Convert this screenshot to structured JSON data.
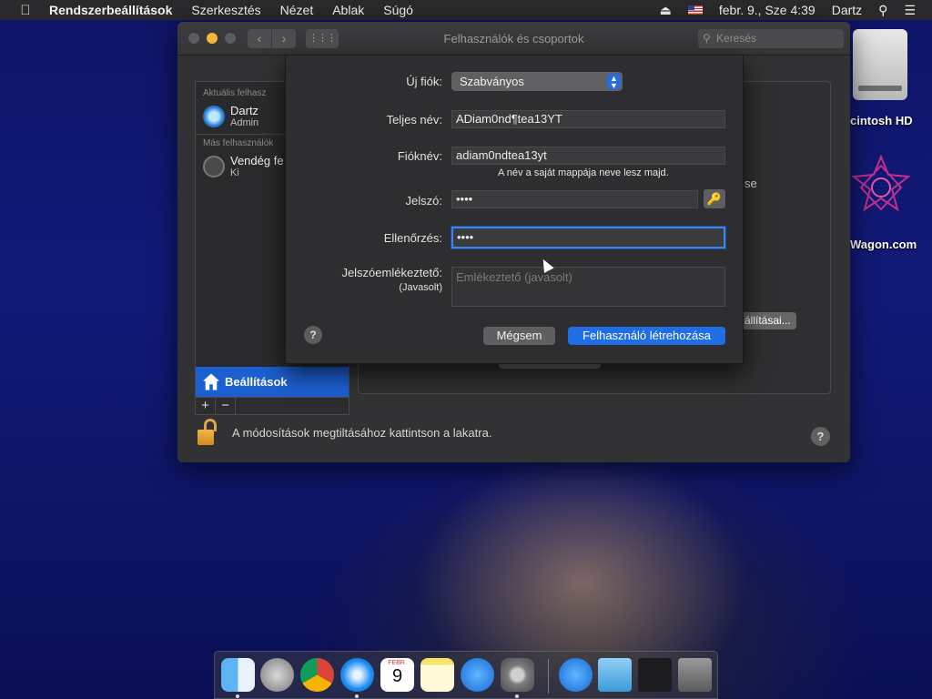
{
  "menubar": {
    "apple": "",
    "app": "Rendszerbeállítások",
    "items": [
      "Szerkesztés",
      "Nézet",
      "Ablak",
      "Súgó"
    ],
    "datetime": "febr. 9., Sze  4:39",
    "user": "Dartz"
  },
  "desktop": {
    "hd_label": "cintosh HD",
    "wagon_label": "Wagon.com"
  },
  "window": {
    "title": "Felhasználók és csoportok",
    "search_placeholder": "Keresés",
    "current_users_header": "Aktuális felhasz",
    "current_user": {
      "name": "Dartz",
      "role": "Admin"
    },
    "other_users_header": "Más felhasználók",
    "guest_user": {
      "name": "Vendég fe",
      "role": "Ki"
    },
    "login_options": "Beállítások",
    "plus": "+",
    "minus": "−",
    "right_fragment_se": "se",
    "right_button_fragment": "állításai...",
    "lock_text": "A módosítások megtiltásához kattintson a lakatra.",
    "help": "?"
  },
  "sheet": {
    "new_account_label": "Új fiók:",
    "account_type": "Szabványos",
    "full_name_label": "Teljes név:",
    "full_name_value": "ADiam0nd¶tea13YT",
    "account_name_label": "Fióknév:",
    "account_name_value": "adiam0ndtea13yt",
    "account_name_note": "A név a saját mappája neve lesz majd.",
    "password_label": "Jelszó:",
    "password_value": "••••",
    "verify_label": "Ellenőrzés:",
    "verify_value": "••••",
    "hint_label": "Jelszóemlékeztető:",
    "hint_sublabel": "(Javasolt)",
    "hint_placeholder": "Emlékeztető (javasolt)",
    "help": "?",
    "cancel": "Mégsem",
    "create": "Felhasználó létrehozása"
  },
  "dock": {
    "calendar_month": "FEBR.",
    "calendar_day": "9"
  }
}
